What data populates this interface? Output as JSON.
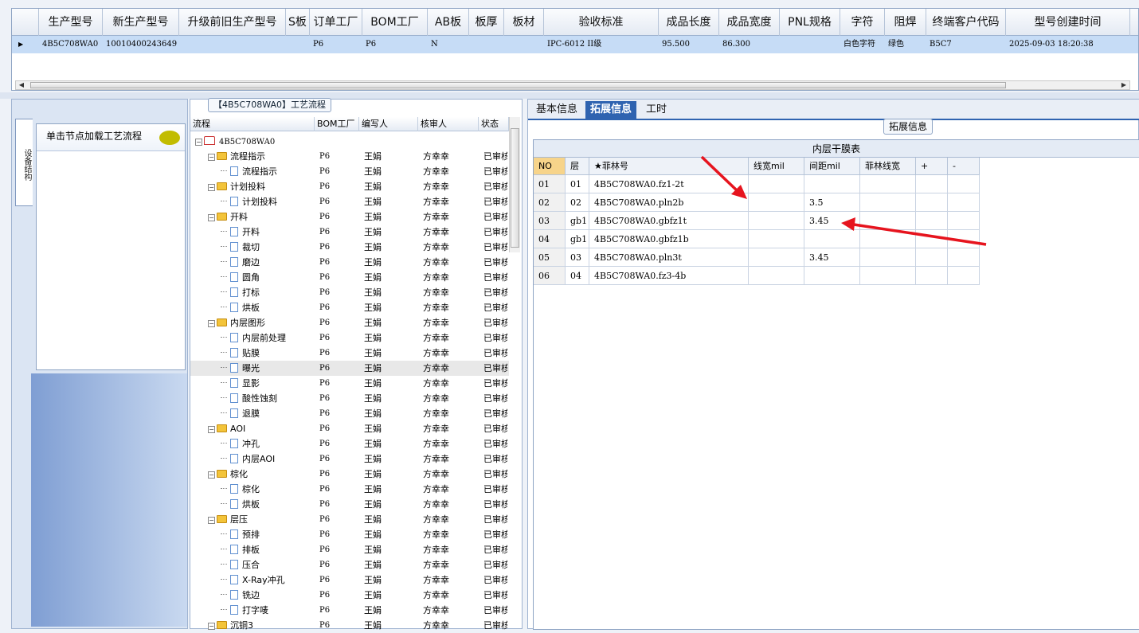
{
  "top_grid": {
    "columns": [
      "生产型号",
      "新生产型号",
      "升级前旧生产型号",
      "S板",
      "订单工厂",
      "BOM工厂",
      "AB板",
      "板厚",
      "板材",
      "验收标准",
      "成品长度",
      "成品宽度",
      "PNL规格",
      "字符",
      "阻焊",
      "终端客户代码",
      "型号创建时间"
    ],
    "row": [
      "4B5C708WA0",
      "10010400243649",
      "",
      "",
      "P6",
      "P6",
      "N",
      "",
      "",
      "IPC-6012 II级",
      "95.500",
      "86.300",
      "",
      "白色字符",
      "绿色",
      "B5C7",
      "2025-09-03 18:20:38"
    ]
  },
  "left_panel": {
    "vertical_tab": "设备结构",
    "load_header": "单击节点加载工艺流程"
  },
  "process_panel": {
    "title": "【4B5C708WA0】工艺流程",
    "columns": [
      "流程",
      "BOM工厂",
      "编写人",
      "核审人",
      "状态"
    ],
    "root": "4B5C708WA0",
    "rows": [
      {
        "name": "流程指示",
        "level": 1,
        "folder": true,
        "bom": "P6",
        "writer": "王娟",
        "reviewer": "方幸幸",
        "status": "已审核"
      },
      {
        "name": "流程指示",
        "level": 2,
        "folder": false,
        "bom": "P6",
        "writer": "王娟",
        "reviewer": "方幸幸",
        "status": "已审核"
      },
      {
        "name": "计划投料",
        "level": 1,
        "folder": true,
        "bom": "P6",
        "writer": "王娟",
        "reviewer": "方幸幸",
        "status": "已审核"
      },
      {
        "name": "计划投料",
        "level": 2,
        "folder": false,
        "bom": "P6",
        "writer": "王娟",
        "reviewer": "方幸幸",
        "status": "已审核"
      },
      {
        "name": "开料",
        "level": 1,
        "folder": true,
        "bom": "P6",
        "writer": "王娟",
        "reviewer": "方幸幸",
        "status": "已审核"
      },
      {
        "name": "开料",
        "level": 2,
        "folder": false,
        "bom": "P6",
        "writer": "王娟",
        "reviewer": "方幸幸",
        "status": "已审核"
      },
      {
        "name": "裁切",
        "level": 2,
        "folder": false,
        "bom": "P6",
        "writer": "王娟",
        "reviewer": "方幸幸",
        "status": "已审核"
      },
      {
        "name": "磨边",
        "level": 2,
        "folder": false,
        "bom": "P6",
        "writer": "王娟",
        "reviewer": "方幸幸",
        "status": "已审核"
      },
      {
        "name": "圆角",
        "level": 2,
        "folder": false,
        "bom": "P6",
        "writer": "王娟",
        "reviewer": "方幸幸",
        "status": "已审核"
      },
      {
        "name": "打标",
        "level": 2,
        "folder": false,
        "bom": "P6",
        "writer": "王娟",
        "reviewer": "方幸幸",
        "status": "已审核"
      },
      {
        "name": "烘板",
        "level": 2,
        "folder": false,
        "bom": "P6",
        "writer": "王娟",
        "reviewer": "方幸幸",
        "status": "已审核"
      },
      {
        "name": "内层图形",
        "level": 1,
        "folder": true,
        "bom": "P6",
        "writer": "王娟",
        "reviewer": "方幸幸",
        "status": "已审核"
      },
      {
        "name": "内层前处理",
        "level": 2,
        "folder": false,
        "bom": "P6",
        "writer": "王娟",
        "reviewer": "方幸幸",
        "status": "已审核"
      },
      {
        "name": "贴膜",
        "level": 2,
        "folder": false,
        "bom": "P6",
        "writer": "王娟",
        "reviewer": "方幸幸",
        "status": "已审核"
      },
      {
        "name": "曝光",
        "level": 2,
        "folder": false,
        "bom": "P6",
        "writer": "王娟",
        "reviewer": "方幸幸",
        "status": "已审核",
        "selected": true
      },
      {
        "name": "显影",
        "level": 2,
        "folder": false,
        "bom": "P6",
        "writer": "王娟",
        "reviewer": "方幸幸",
        "status": "已审核"
      },
      {
        "name": "酸性蚀刻",
        "level": 2,
        "folder": false,
        "bom": "P6",
        "writer": "王娟",
        "reviewer": "方幸幸",
        "status": "已审核"
      },
      {
        "name": "退膜",
        "level": 2,
        "folder": false,
        "bom": "P6",
        "writer": "王娟",
        "reviewer": "方幸幸",
        "status": "已审核"
      },
      {
        "name": "AOI",
        "level": 1,
        "folder": true,
        "bom": "P6",
        "writer": "王娟",
        "reviewer": "方幸幸",
        "status": "已审核"
      },
      {
        "name": "冲孔",
        "level": 2,
        "folder": false,
        "bom": "P6",
        "writer": "王娟",
        "reviewer": "方幸幸",
        "status": "已审核"
      },
      {
        "name": "内层AOI",
        "level": 2,
        "folder": false,
        "bom": "P6",
        "writer": "王娟",
        "reviewer": "方幸幸",
        "status": "已审核"
      },
      {
        "name": "棕化",
        "level": 1,
        "folder": true,
        "bom": "P6",
        "writer": "王娟",
        "reviewer": "方幸幸",
        "status": "已审核"
      },
      {
        "name": "棕化",
        "level": 2,
        "folder": false,
        "bom": "P6",
        "writer": "王娟",
        "reviewer": "方幸幸",
        "status": "已审核"
      },
      {
        "name": "烘板",
        "level": 2,
        "folder": false,
        "bom": "P6",
        "writer": "王娟",
        "reviewer": "方幸幸",
        "status": "已审核"
      },
      {
        "name": "层压",
        "level": 1,
        "folder": true,
        "bom": "P6",
        "writer": "王娟",
        "reviewer": "方幸幸",
        "status": "已审核"
      },
      {
        "name": "预排",
        "level": 2,
        "folder": false,
        "bom": "P6",
        "writer": "王娟",
        "reviewer": "方幸幸",
        "status": "已审核"
      },
      {
        "name": "排板",
        "level": 2,
        "folder": false,
        "bom": "P6",
        "writer": "王娟",
        "reviewer": "方幸幸",
        "status": "已审核"
      },
      {
        "name": "压合",
        "level": 2,
        "folder": false,
        "bom": "P6",
        "writer": "王娟",
        "reviewer": "方幸幸",
        "status": "已审核"
      },
      {
        "name": "X-Ray冲孔",
        "level": 2,
        "folder": false,
        "bom": "P6",
        "writer": "王娟",
        "reviewer": "方幸幸",
        "status": "已审核"
      },
      {
        "name": "铣边",
        "level": 2,
        "folder": false,
        "bom": "P6",
        "writer": "王娟",
        "reviewer": "方幸幸",
        "status": "已审核"
      },
      {
        "name": "打字唛",
        "level": 2,
        "folder": false,
        "bom": "P6",
        "writer": "王娟",
        "reviewer": "方幸幸",
        "status": "已审核"
      },
      {
        "name": "沉铜3",
        "level": 1,
        "folder": true,
        "bom": "P6",
        "writer": "王娟",
        "reviewer": "方幸幸",
        "status": "已审核"
      }
    ]
  },
  "right_panel": {
    "tabs": [
      "基本信息",
      "拓展信息",
      "工时"
    ],
    "active_tab": "拓展信息",
    "group_label": "拓展信息",
    "table_title": "内层干膜表",
    "columns": [
      "NO",
      "层",
      "★菲林号",
      "线宽mil",
      "间距mil",
      "菲林线宽",
      "+",
      "-"
    ],
    "rows": [
      [
        "01",
        "01",
        "4B5C708WA0.fz1-2t",
        "",
        "",
        "",
        "",
        ""
      ],
      [
        "02",
        "02",
        "4B5C708WA0.pln2b",
        "",
        "3.5",
        "",
        "",
        ""
      ],
      [
        "03",
        "gb1",
        "4B5C708WA0.gbfz1t",
        "",
        "3.45",
        "",
        "",
        ""
      ],
      [
        "04",
        "gb1",
        "4B5C708WA0.gbfz1b",
        "",
        "",
        "",
        "",
        ""
      ],
      [
        "05",
        "03",
        "4B5C708WA0.pln3t",
        "",
        "3.45",
        "",
        "",
        ""
      ],
      [
        "06",
        "04",
        "4B5C708WA0.fz3-4b",
        "",
        "",
        "",
        "",
        ""
      ]
    ]
  },
  "colors": {
    "accent": "#2f63b0",
    "selection": "#c6dcf6",
    "annotation": "#e6141e"
  }
}
